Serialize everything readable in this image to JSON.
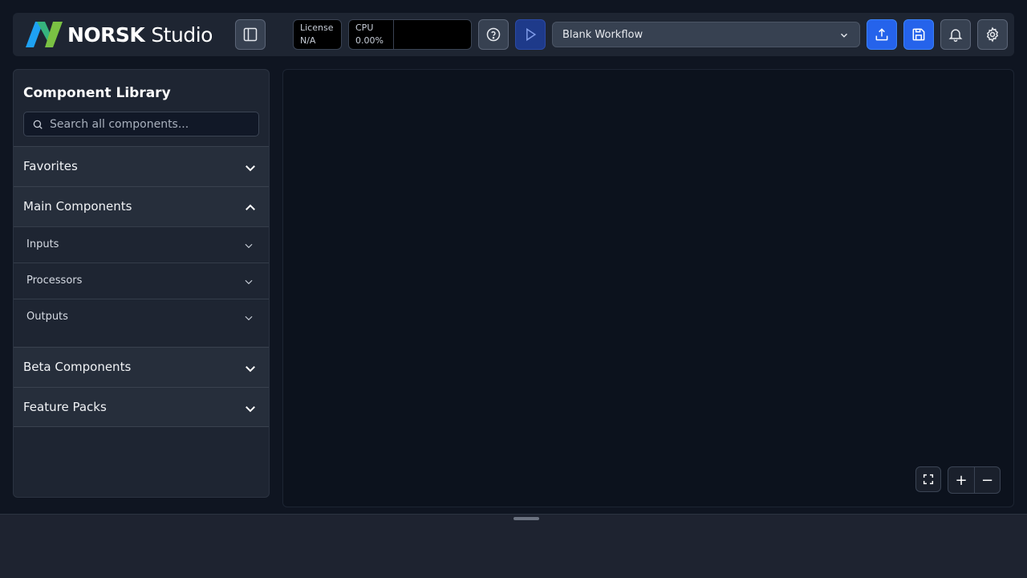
{
  "header": {
    "logo_brand": "NORSK",
    "logo_product": "Studio",
    "license": {
      "label": "License",
      "value": "N/A"
    },
    "cpu": {
      "label": "CPU",
      "value": "0.00%"
    },
    "workflow_select": "Blank Workflow"
  },
  "sidebar": {
    "title": "Component Library",
    "search_placeholder": "Search all components...",
    "sections": [
      {
        "label": "Favorites",
        "expanded": false
      },
      {
        "label": "Main Components",
        "expanded": true,
        "children": [
          {
            "label": "Inputs"
          },
          {
            "label": "Processors"
          },
          {
            "label": "Outputs"
          }
        ]
      },
      {
        "label": "Beta Components",
        "expanded": false
      },
      {
        "label": "Feature Packs",
        "expanded": false
      }
    ]
  },
  "canvas_controls": {
    "fit": "fullscreen-icon",
    "zoom_in": "+",
    "zoom_out": "−"
  },
  "colors": {
    "accent": "#2563eb",
    "background": "#0f1521",
    "panel": "#1e2532",
    "logo_blue": "#1ea1f2",
    "logo_green": "#7ac143"
  },
  "icons": [
    "logo-icon",
    "panel-toggle-icon",
    "help-icon",
    "play-icon",
    "chevron-down-icon",
    "upload-icon",
    "save-icon",
    "bell-icon",
    "gear-icon",
    "search-icon",
    "chevron-up-icon",
    "fullscreen-icon"
  ]
}
